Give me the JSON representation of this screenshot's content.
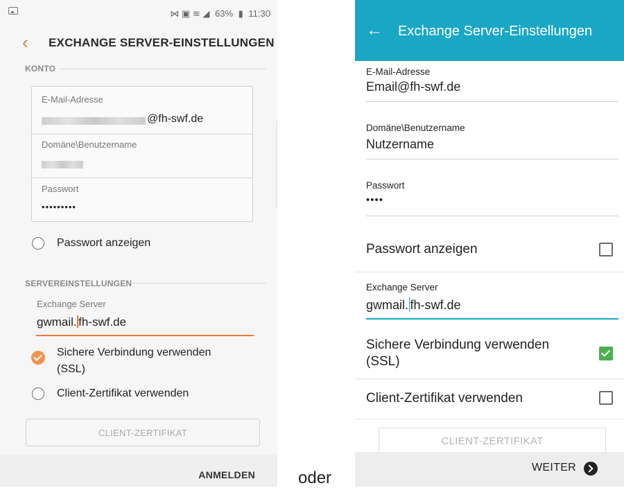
{
  "left": {
    "status": {
      "right_text": "63%",
      "time": "11:30",
      "signal_glyphs": "⋈ ▣ ≋ ◢"
    },
    "title": "EXCHANGE SERVER-EINSTELLUNGEN",
    "konto_section": "KONTO",
    "email": {
      "label": "E-Mail-Adresse",
      "value_suffix": "@fh-swf.de"
    },
    "domain": {
      "label": "Domäne\\Benutzername"
    },
    "password": {
      "label": "Passwort",
      "value": "•••••••••"
    },
    "show_password": "Passwort anzeigen",
    "server_section": "SERVEREINSTELLUNGEN",
    "exchange_server": {
      "label": "Exchange Server",
      "value_before_cursor": "gwmail.",
      "value_after_cursor": "fh-swf.de"
    },
    "ssl_line1": "Sichere Verbindung verwenden",
    "ssl_line2": "(SSL)",
    "client_cert": "Client-Zertifikat verwenden",
    "client_cert_button": "CLIENT-ZERTIFIKAT",
    "login_button": "ANMELDEN",
    "accent_color": "#e8793c"
  },
  "separator_text": "oder",
  "right": {
    "title": "Exchange Server-Einstellungen",
    "email": {
      "label": "E-Mail-Adresse",
      "value": "Email@fh-swf.de"
    },
    "domain": {
      "label": "Domäne\\Benutzername",
      "value": "Nutzername"
    },
    "password": {
      "label": "Passwort",
      "value": "••••"
    },
    "show_password": "Passwort anzeigen",
    "exchange_server": {
      "label": "Exchange Server",
      "value_before_cursor": "gwmail.",
      "value_after_cursor": "fh-swf.de"
    },
    "ssl_line1": "Sichere Verbindung verwenden",
    "ssl_line2": "(SSL)",
    "client_cert": "Client-Zertifikat verwenden",
    "client_cert_button": "CLIENT-ZERTIFIKAT",
    "next_button": "WEITER",
    "accent_color": "#1aa7c5",
    "check_color": "#4caf50"
  }
}
